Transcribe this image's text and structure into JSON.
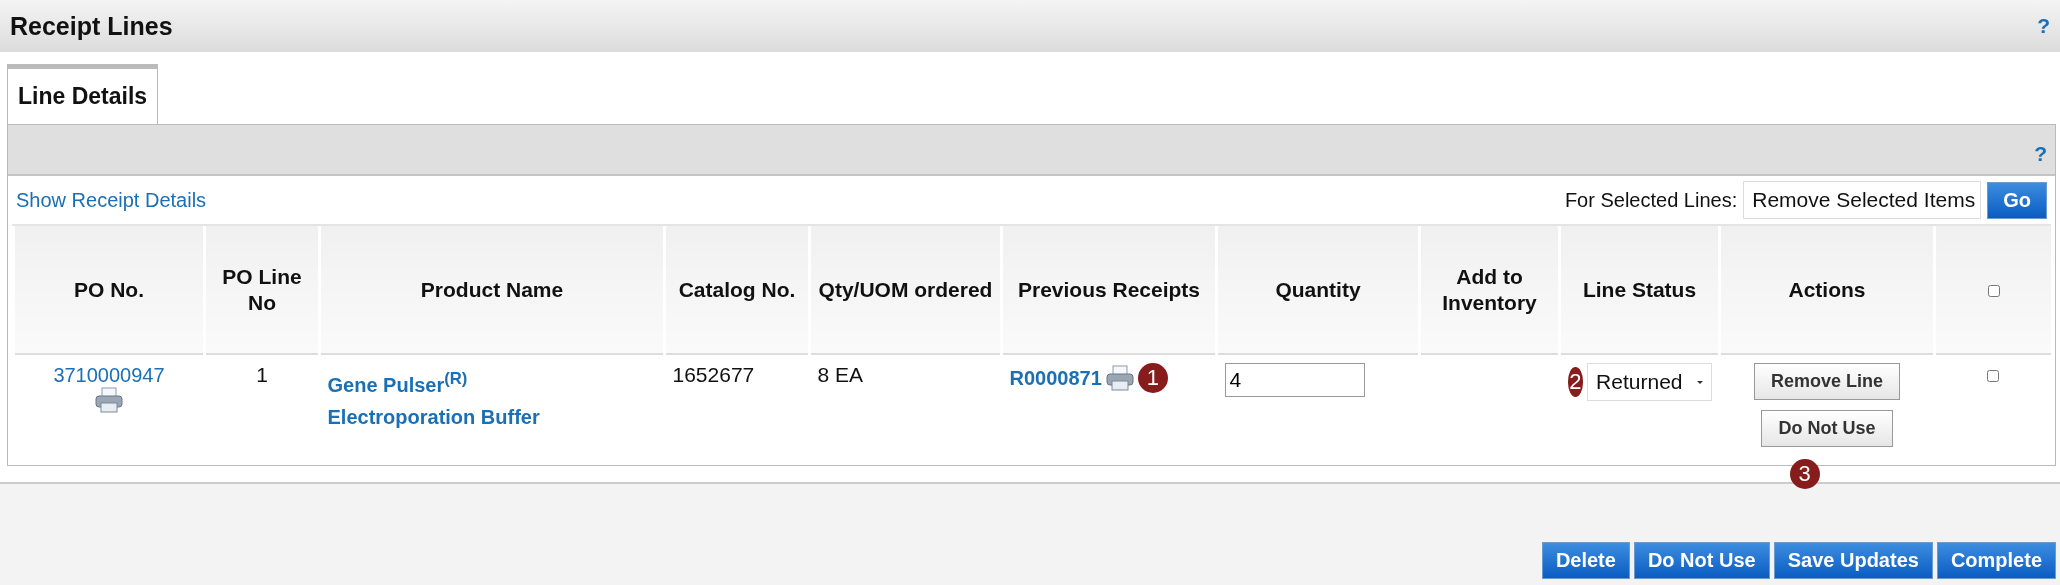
{
  "panel": {
    "title": "Receipt Lines",
    "help": "?"
  },
  "tabs": [
    {
      "label": "Line Details",
      "selected": true
    }
  ],
  "tab_help": "?",
  "show_details_link": "Show Receipt Details",
  "bulk_action": {
    "label": "For Selected Lines:",
    "value": "Remove Selected Items",
    "button": "Go"
  },
  "table": {
    "columns": [
      {
        "kind": "text",
        "label": "PO No."
      },
      {
        "kind": "text",
        "label": "PO Line No"
      },
      {
        "kind": "text",
        "label": "Product Name"
      },
      {
        "kind": "text",
        "label": "Catalog No."
      },
      {
        "kind": "text",
        "label": "Qty/UOM ordered"
      },
      {
        "kind": "text",
        "label": "Previous Receipts"
      },
      {
        "kind": "text",
        "label": "Quantity"
      },
      {
        "kind": "text",
        "label": "Add to Inventory"
      },
      {
        "kind": "text",
        "label": "Line Status"
      },
      {
        "kind": "text",
        "label": "Actions"
      },
      {
        "kind": "checkbox",
        "checked": false
      }
    ],
    "rows": [
      {
        "po_no": "3710000947",
        "po_line": "1",
        "product_name": "Gene Pulser$^{(R)}$ Electroporation Buffer",
        "catalog_no": "1652677",
        "qty_uom": "8 EA",
        "previous_receipt": "R0000871",
        "receipt_callout": "1",
        "quantity": "4",
        "status_callout": "2",
        "line_status": "Returned",
        "actions": [
          "Remove Line",
          "Do Not Use"
        ],
        "actions_callout": "3",
        "checked": false
      }
    ]
  },
  "footer_buttons": [
    "Delete",
    "Do Not Use",
    "Save Updates",
    "Complete"
  ]
}
